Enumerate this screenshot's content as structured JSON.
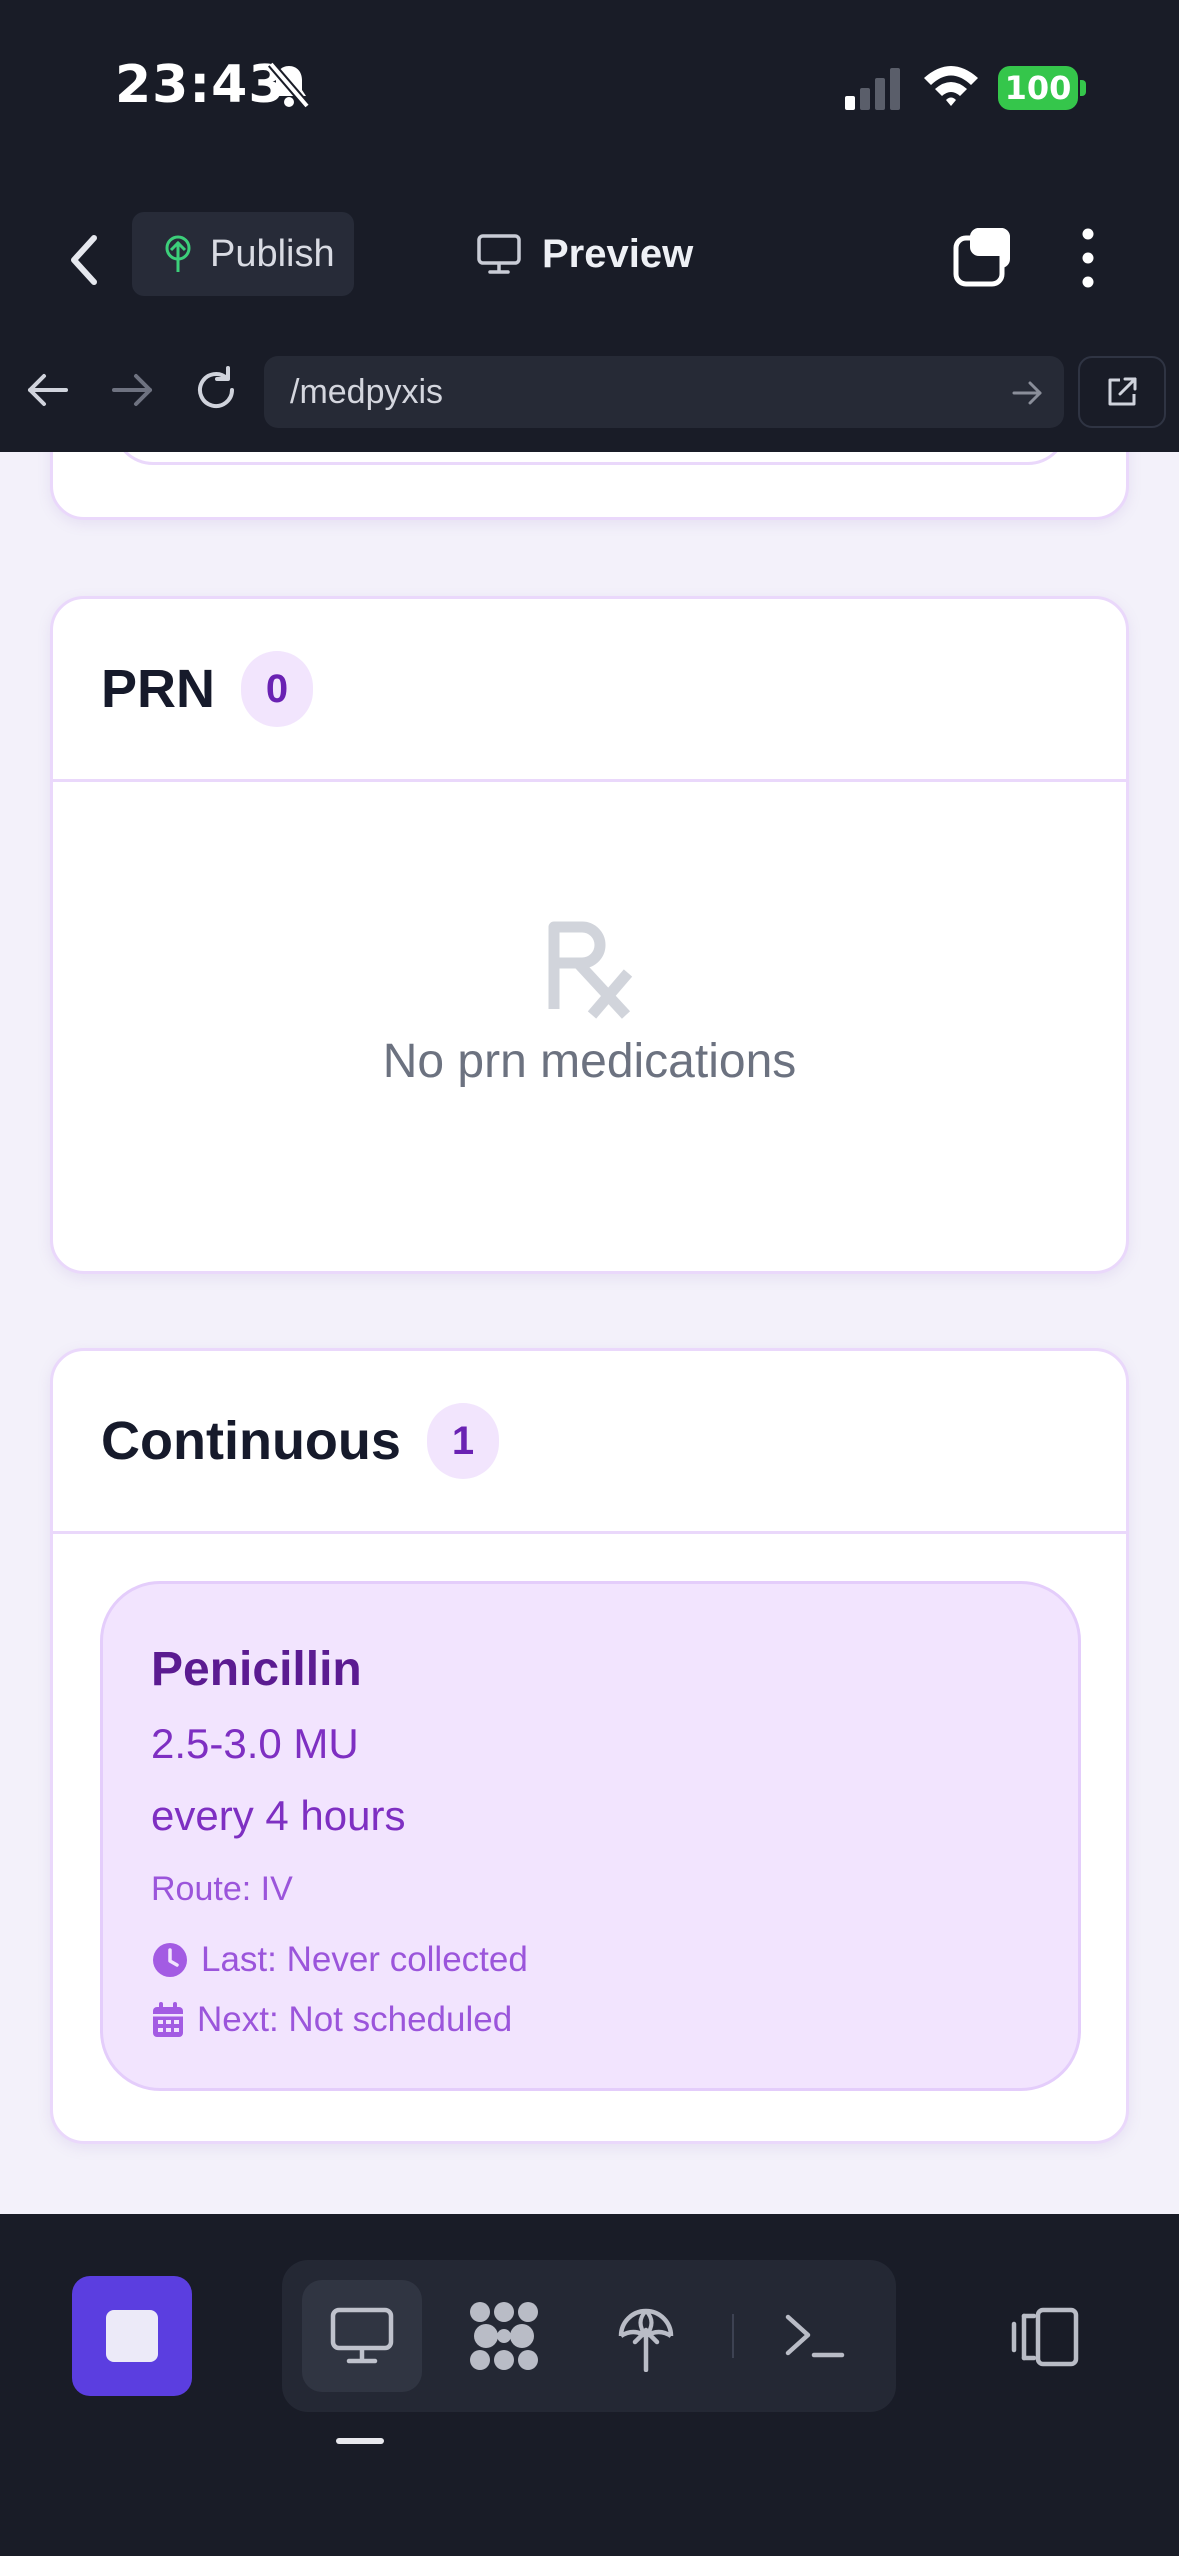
{
  "status_bar": {
    "time": "23:43",
    "battery": "100",
    "icons": [
      "bell-slash-icon",
      "cellular-signal-icon",
      "wifi-icon",
      "battery-icon"
    ]
  },
  "toolbar": {
    "publish_label": "Publish",
    "preview_label": "Preview",
    "icons": [
      "chevron-left-icon",
      "publish-tree-icon",
      "monitor-icon",
      "tabs-icon",
      "more-vertical-icon"
    ]
  },
  "browser": {
    "url": "/medpyxis",
    "icons": [
      "arrow-left-icon",
      "arrow-right-icon",
      "reload-icon",
      "go-arrow-icon",
      "external-link-icon"
    ]
  },
  "prn_section": {
    "title": "PRN",
    "count": "0",
    "empty_text": "No prn medications",
    "empty_icon": "rx-icon"
  },
  "continuous_section": {
    "title": "Continuous",
    "count": "1",
    "medications": [
      {
        "name": "Penicillin",
        "dose": "2.5-3.0 MU",
        "frequency": "every 4 hours",
        "route": "Route: IV",
        "last": "Last: Never collected",
        "next": "Next: Not scheduled"
      }
    ]
  },
  "bottom_bar": {
    "icons": [
      "stop-icon",
      "monitor-icon",
      "apps-grid-icon",
      "deploy-icon",
      "terminal-icon",
      "side-panel-icon"
    ],
    "active_tab": "monitor"
  },
  "colors": {
    "chrome_bg": "#191c27",
    "accent_purple": "#5b3ee0",
    "med_card_bg": "#f2e4fe",
    "battery_green": "#35c64b"
  }
}
